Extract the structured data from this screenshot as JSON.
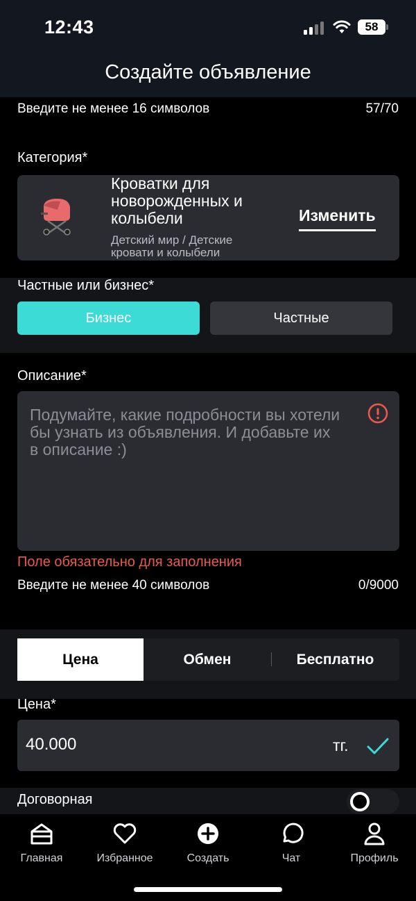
{
  "status_bar": {
    "time": "12:43",
    "battery": "58"
  },
  "header": {
    "title": "Создайте объявление"
  },
  "title_hint": {
    "text": "Введите не менее 16 символов",
    "counter": "57/70"
  },
  "category": {
    "label": "Категория*",
    "name": "Кроватки для новорожденных и колыбели",
    "path": "Детский мир / Детские кровати и колыбели",
    "change_label": "Изменить"
  },
  "seller_type": {
    "label": "Частные или бизнес*",
    "options": [
      "Бизнес",
      "Частные"
    ],
    "selected": "Бизнес"
  },
  "description": {
    "label": "Описание*",
    "placeholder": "Подумайте, какие подробности вы хотели бы узнать из объявления. И добавьте их в описание :)",
    "error": "Поле обязательно для заполнения",
    "hint": "Введите не менее 40 символов",
    "counter": "0/9000"
  },
  "price_mode": {
    "tabs": [
      "Цена",
      "Обмен",
      "Бесплатно"
    ],
    "selected": "Цена"
  },
  "price": {
    "label": "Цена*",
    "value": "40.000",
    "currency": "тг."
  },
  "negotiable": {
    "label": "Договорная",
    "enabled": false
  },
  "tabbar": {
    "items": [
      {
        "label": "Главная",
        "icon": "home-icon"
      },
      {
        "label": "Избранное",
        "icon": "heart-icon"
      },
      {
        "label": "Создать",
        "icon": "plus-circle-icon"
      },
      {
        "label": "Чат",
        "icon": "chat-bubble-icon"
      },
      {
        "label": "Профиль",
        "icon": "user-icon"
      }
    ]
  },
  "colors": {
    "accent": "#3cdbd6",
    "error": "#ea5a4c",
    "surface": "#2a2c31"
  }
}
